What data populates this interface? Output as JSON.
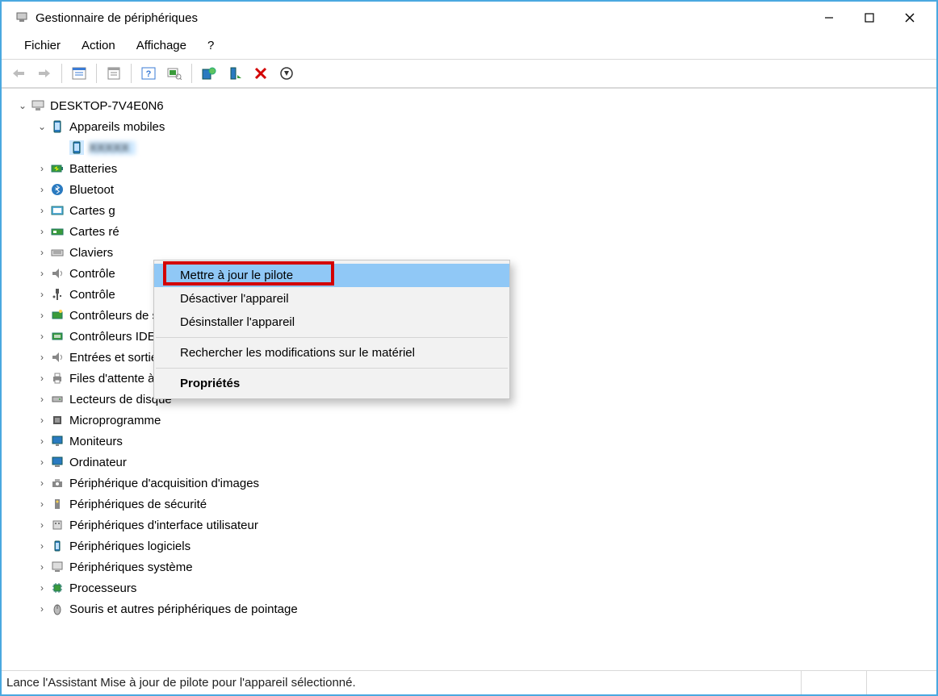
{
  "window": {
    "title": "Gestionnaire de périphériques"
  },
  "menubar": {
    "file": "Fichier",
    "action": "Action",
    "view": "Affichage",
    "help": "?"
  },
  "status": "Lance l'Assistant Mise à jour de pilote pour l'appareil sélectionné.",
  "tree": {
    "root": "DESKTOP-7V4E0N6",
    "mobile": "Appareils mobiles",
    "mobile_device": "XXXXX",
    "batteries": "Batteries",
    "bluetooth": "Bluetoot",
    "cartes_g": "Cartes g",
    "cartes_r": "Cartes ré",
    "claviers": "Claviers",
    "controle1": "Contrôle",
    "controle2": "Contrôle",
    "ctrl_stockage": "Contrôleurs de stockage",
    "ctrl_ide": "Contrôleurs IDE ATA/ATAPI",
    "audio": "Entrées et sorties audio",
    "print_queue": "Files d'attente à l'impression :",
    "disques": "Lecteurs de disque",
    "micro": "Microprogramme",
    "moniteurs": "Moniteurs",
    "ordinateur": "Ordinateur",
    "acq_images": "Périphérique d'acquisition d'images",
    "securite": "Périphériques de sécurité",
    "interface_util": "Périphériques d'interface utilisateur",
    "logiciels": "Périphériques logiciels",
    "systeme": "Périphériques système",
    "processeurs": "Processeurs",
    "souris": "Souris et autres périphériques de pointage"
  },
  "context_menu": {
    "update_driver": "Mettre à jour le pilote",
    "disable": "Désactiver l'appareil",
    "uninstall": "Désinstaller l'appareil",
    "scan": "Rechercher les modifications sur le matériel",
    "properties": "Propriétés"
  }
}
